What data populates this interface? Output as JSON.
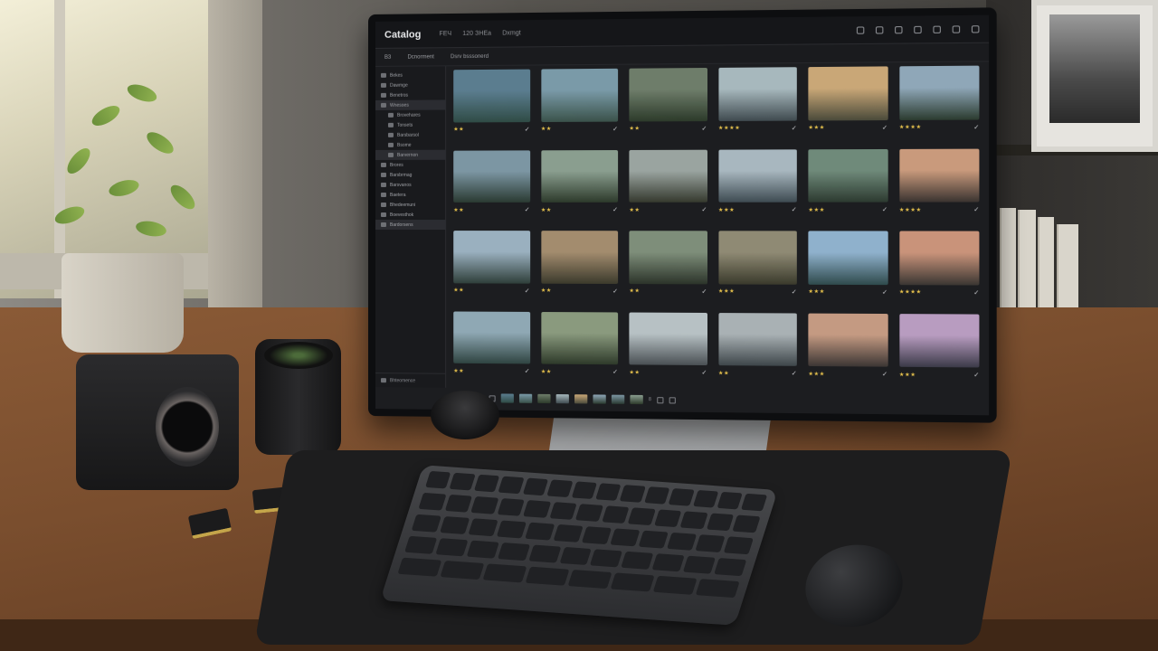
{
  "app": {
    "title": "Catalog",
    "menu": [
      "FЕЧ",
      "120 ЗНЕа",
      "Dxmgt"
    ]
  },
  "toolbar": {
    "items": [
      "ВЗ",
      "Dcnorment",
      "Dsrv bsssonerd"
    ]
  },
  "sidebar": {
    "items": [
      {
        "label": "Bekes",
        "child": false,
        "active": false
      },
      {
        "label": "Dawmge",
        "child": false,
        "active": false
      },
      {
        "label": "Benetros",
        "child": false,
        "active": false
      },
      {
        "label": "Wnesoes",
        "child": false,
        "active": true
      },
      {
        "label": "Brovehares",
        "child": true,
        "active": false
      },
      {
        "label": "Tonsets",
        "child": true,
        "active": false
      },
      {
        "label": "Barsbarsol",
        "child": true,
        "active": false
      },
      {
        "label": "Bsome",
        "child": true,
        "active": false
      },
      {
        "label": "Barvernon",
        "child": true,
        "active": true
      },
      {
        "label": "Brores",
        "child": false,
        "active": false
      },
      {
        "label": "Barsbrmag",
        "child": false,
        "active": false
      },
      {
        "label": "Barsvanos",
        "child": false,
        "active": false
      },
      {
        "label": "Baetera",
        "child": false,
        "active": false
      },
      {
        "label": "Bhedeemuni",
        "child": false,
        "active": false
      },
      {
        "label": "Boevesthok",
        "child": false,
        "active": false
      },
      {
        "label": "Bardorsens",
        "child": false,
        "active": true
      }
    ],
    "bottom": "Bhteomence"
  },
  "grid": {
    "rating_counts": [
      2,
      2,
      2,
      4,
      3,
      4,
      2,
      2,
      2,
      3,
      3,
      4,
      2,
      2,
      2,
      3,
      3,
      4,
      2,
      2,
      2,
      2,
      3,
      3
    ],
    "colors": [
      [
        "#5b7d8f",
        "#2f4b45"
      ],
      [
        "#7a9aa8",
        "#3a524a"
      ],
      [
        "#6e7d6a",
        "#2c3a2a"
      ],
      [
        "#a7b8bd",
        "#3f4a4f"
      ],
      [
        "#c9a777",
        "#4a4a3a"
      ],
      [
        "#8fa7b8",
        "#2b3b2f"
      ],
      [
        "#7c96a3",
        "#2a3a32"
      ],
      [
        "#8a9e8f",
        "#2d3a2b"
      ],
      [
        "#9aa4a0",
        "#35392e"
      ],
      [
        "#a8b7bf",
        "#3e4b52"
      ],
      [
        "#6f8a7a",
        "#2c3a30"
      ],
      [
        "#c99a7c",
        "#3a3330"
      ],
      [
        "#9ab0bf",
        "#2f3f3a"
      ],
      [
        "#a38c6e",
        "#3b3a2c"
      ],
      [
        "#7e8e7a",
        "#2c342a"
      ],
      [
        "#8f8a74",
        "#3a3a2c"
      ],
      [
        "#8fb1cc",
        "#2f4a4c"
      ],
      [
        "#c9937a",
        "#3a3632"
      ],
      [
        "#8fa8b4",
        "#2f4441"
      ],
      [
        "#8a9a7e",
        "#2e3a2a"
      ],
      [
        "#b7c1c4",
        "#4a5054"
      ],
      [
        "#a9b1b4",
        "#3e464a"
      ],
      [
        "#c49a82",
        "#3c3634"
      ],
      [
        "#b89cc0",
        "#3b3a48"
      ]
    ],
    "check": "✓"
  },
  "filmstrip": {
    "count": "8"
  }
}
